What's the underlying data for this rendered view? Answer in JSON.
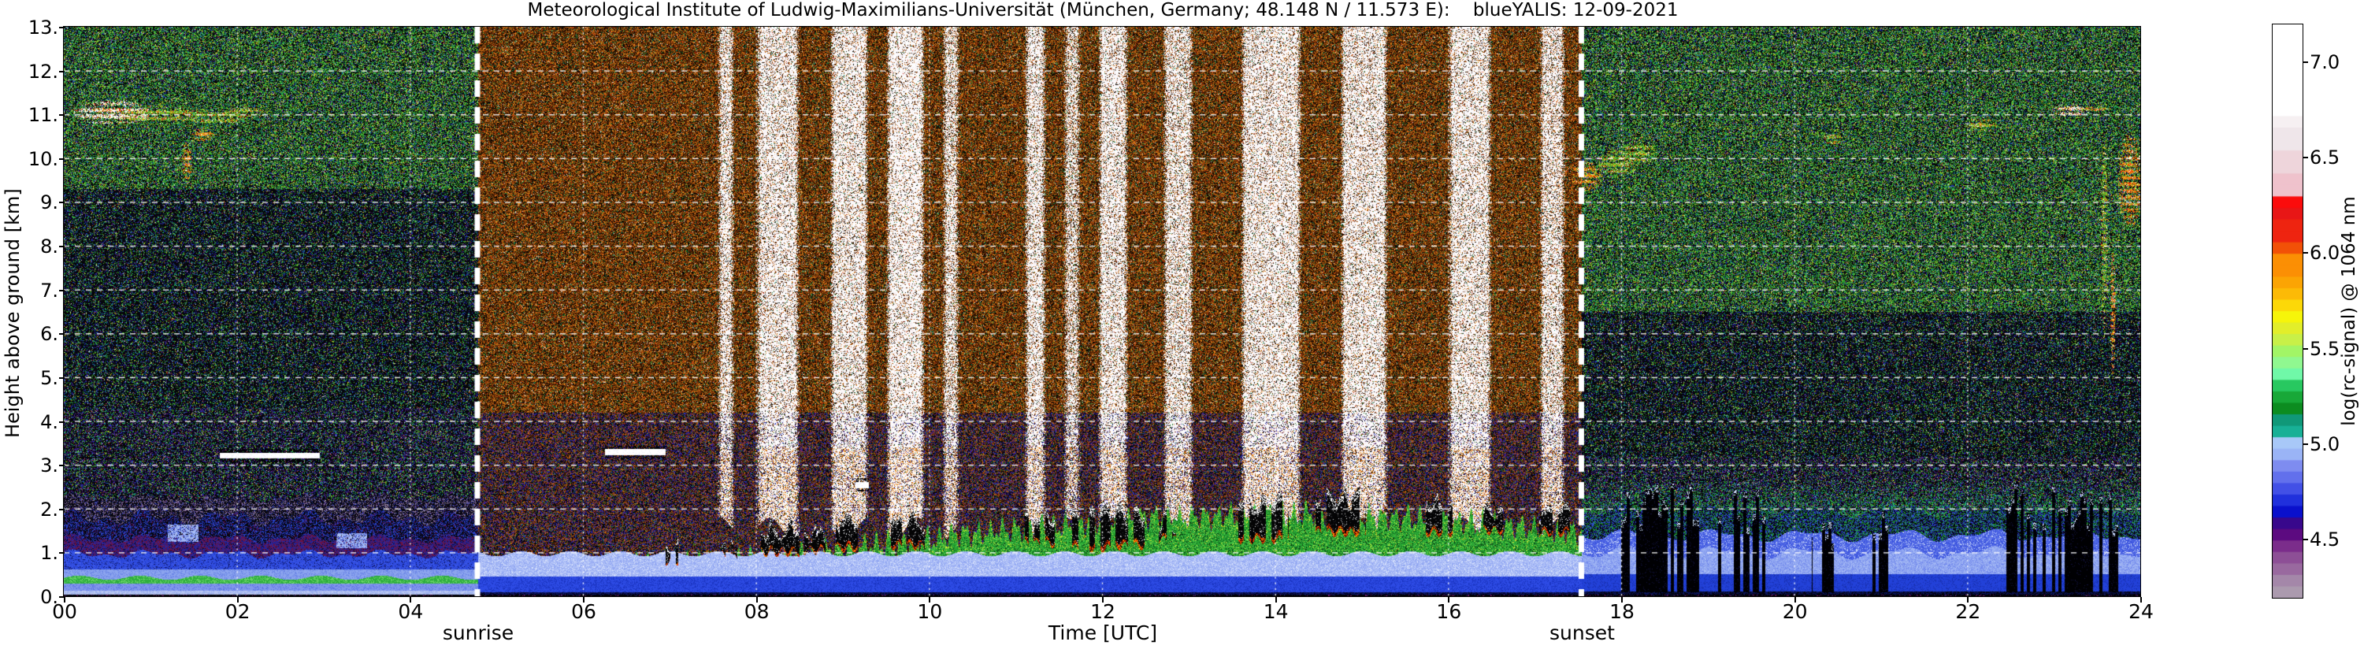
{
  "title": "Meteorological Institute of Ludwig-Maximilians-Universität (München, Germany; 48.148 N / 11.573 E):    blueYALIS: 12-09-2021",
  "axes": {
    "x_label": "Time [UTC]",
    "y_label": "Height above ground [km]",
    "x_ticks": [
      "00",
      "02",
      "04",
      "06",
      "08",
      "10",
      "12",
      "14",
      "16",
      "18",
      "20",
      "22",
      "24"
    ],
    "x_tick_hours": [
      0,
      2,
      4,
      6,
      8,
      10,
      12,
      14,
      16,
      18,
      20,
      22,
      24
    ],
    "y_ticks": [
      "0.",
      "1.",
      "2.",
      "3.",
      "4.",
      "5.",
      "6.",
      "7.",
      "8.",
      "9.",
      "10.",
      "11.",
      "12.",
      "13."
    ],
    "y_tick_km": [
      0,
      1,
      2,
      3,
      4,
      5,
      6,
      7,
      8,
      9,
      10,
      11,
      12,
      13
    ]
  },
  "annotations": {
    "sunrise": "sunrise",
    "sunset": "sunset"
  },
  "colorbar": {
    "label": "log(rc-signal) @ 1064 nm",
    "ticks": [
      "7.0",
      "6.5",
      "6.0",
      "5.5",
      "5.0",
      "4.5"
    ],
    "tick_values": [
      7.0,
      6.5,
      6.0,
      5.5,
      5.0,
      4.5
    ],
    "value_range": [
      4.2,
      7.2
    ],
    "bands": 50,
    "stops_desc": [
      [
        7.2,
        "#ffffff"
      ],
      [
        6.72,
        "#ffffff"
      ],
      [
        6.64,
        "#f6f0f2"
      ],
      [
        6.56,
        "#efe6ea"
      ],
      [
        6.44,
        "#eed5db"
      ],
      [
        6.32,
        "#efc2cc"
      ],
      [
        6.24,
        "#fb0c0c"
      ],
      [
        6.16,
        "#e81616"
      ],
      [
        6.06,
        "#ee2410"
      ],
      [
        5.98,
        "#f25107"
      ],
      [
        5.9,
        "#fb8f04"
      ],
      [
        5.82,
        "#fba404"
      ],
      [
        5.74,
        "#fcba06"
      ],
      [
        5.68,
        "#fcd808"
      ],
      [
        5.62,
        "#f6f50a"
      ],
      [
        5.56,
        "#e2ee2a"
      ],
      [
        5.5,
        "#c8f048"
      ],
      [
        5.455,
        "#a2f566"
      ],
      [
        5.41,
        "#90f890"
      ],
      [
        5.365,
        "#70f8a8"
      ],
      [
        5.32,
        "#38e088"
      ],
      [
        5.275,
        "#28c860"
      ],
      [
        5.23,
        "#18a838"
      ],
      [
        5.185,
        "#0c8c20"
      ],
      [
        5.14,
        "#087018"
      ],
      [
        5.095,
        "#109878"
      ],
      [
        5.05,
        "#18b096"
      ],
      [
        5.005,
        "#a8c8f8"
      ],
      [
        4.95,
        "#9ab4f6"
      ],
      [
        4.9,
        "#8ca0f4"
      ],
      [
        4.85,
        "#7e8cf0"
      ],
      [
        4.8,
        "#6270ec"
      ],
      [
        4.75,
        "#4250e6"
      ],
      [
        4.7,
        "#2030dc"
      ],
      [
        4.65,
        "#0a10cc"
      ],
      [
        4.6,
        "#1808a8"
      ],
      [
        4.55,
        "#38088c"
      ],
      [
        4.5,
        "#5c0a80"
      ],
      [
        4.45,
        "#7b2d8b"
      ],
      [
        4.4,
        "#8d4f96"
      ],
      [
        4.35,
        "#99699f"
      ],
      [
        4.29,
        "#a487a9"
      ],
      [
        4.2,
        "#ab9aae"
      ]
    ]
  },
  "chart_data": {
    "type": "heatmap",
    "title": "Meteorological Institute of Ludwig-Maximilians-Universität (München, Germany; 48.148 N / 11.573 E):    blueYALIS: 12-09-2021",
    "instrument": "blueYALIS",
    "date": "12-09-2021",
    "location": "48.148 N / 11.573 E",
    "xlabel": "Time [UTC]",
    "ylabel": "Height above ground [km]",
    "value_label": "log(rc-signal) @ 1064 nm",
    "x_range": [
      0,
      24
    ],
    "y_range": [
      0,
      13
    ],
    "value_range": [
      4.2,
      7.2
    ],
    "sunrise_utc": 4.78,
    "sunset_utc": 17.54,
    "grid": {
      "h_lines_km": [
        1,
        2,
        3,
        4,
        5,
        6,
        7,
        8,
        9,
        10,
        11,
        12
      ],
      "v_lines_hours": [
        2,
        4,
        6,
        8,
        10,
        12,
        14,
        16,
        18,
        20,
        22
      ]
    },
    "description": "Lidar range-corrected signal quicklook: night-time dark speckle background, daylight brown noise between sunrise and sunset dashed lines, cirrus 10-11.5 km near 00-02 UTC and 22-24 UTC, boundary-layer aerosol below ~2 km, daytime cumulus with black attenuation streaks 1-2.3 km, bright saturated columns during day, dark vertical streaks after sunset.",
    "features": {
      "bl_top_day": [
        [
          5,
          0.55
        ],
        [
          7,
          0.7
        ],
        [
          8,
          0.9
        ],
        [
          9.5,
          1.2
        ],
        [
          11,
          1.55
        ],
        [
          12.5,
          1.8
        ],
        [
          14,
          1.9
        ],
        [
          15.5,
          1.8
        ],
        [
          16.5,
          1.65
        ],
        [
          17.6,
          1.45
        ]
      ],
      "bright_stripes": [
        [
          7.55,
          7.75,
          0.85
        ],
        [
          8.0,
          8.5,
          0.9
        ],
        [
          8.85,
          9.3,
          0.9
        ],
        [
          9.5,
          9.95,
          0.95
        ],
        [
          10.15,
          10.35,
          0.8
        ],
        [
          11.1,
          11.35,
          0.9
        ],
        [
          11.55,
          11.75,
          0.75
        ],
        [
          11.95,
          12.3,
          0.9
        ],
        [
          12.7,
          13.05,
          0.85
        ],
        [
          13.6,
          14.3,
          0.9
        ],
        [
          14.75,
          15.3,
          0.9
        ],
        [
          16.0,
          16.5,
          0.9
        ],
        [
          17.05,
          17.35,
          0.85
        ]
      ],
      "cumulus": [
        [
          6.95,
          7.1,
          0.8,
          1.1
        ],
        [
          7.6,
          7.78,
          0.95,
          1.25
        ],
        [
          8.05,
          8.5,
          1.0,
          1.55
        ],
        [
          8.55,
          8.8,
          1.05,
          1.5
        ],
        [
          8.85,
          9.25,
          1.1,
          1.75
        ],
        [
          9.55,
          9.95,
          1.15,
          1.7
        ],
        [
          11.1,
          11.45,
          1.2,
          1.85
        ],
        [
          11.65,
          12.1,
          1.1,
          1.9
        ],
        [
          12.15,
          12.5,
          1.15,
          1.95
        ],
        [
          12.65,
          12.85,
          1.3,
          1.75
        ],
        [
          13.55,
          14.15,
          1.3,
          2.15
        ],
        [
          14.4,
          15.05,
          1.45,
          2.3
        ],
        [
          15.7,
          16.05,
          1.45,
          2.1
        ],
        [
          16.4,
          16.65,
          1.5,
          2.0
        ],
        [
          17.05,
          17.4,
          1.45,
          2.0
        ]
      ],
      "dark_streaks": [
        [
          18.0,
          18.9,
          2.3,
          0.78
        ],
        [
          19.1,
          19.8,
          2.2,
          0.6
        ],
        [
          20.2,
          20.45,
          1.8,
          0.4
        ],
        [
          20.9,
          21.15,
          2.0,
          0.5
        ],
        [
          22.45,
          23.8,
          2.3,
          0.72
        ]
      ],
      "cloud_blobs": [
        [
          0.55,
          11.05,
          0.45,
          0.28,
          2
        ],
        [
          1.1,
          11.0,
          0.55,
          0.22,
          0
        ],
        [
          1.75,
          10.95,
          0.35,
          0.18,
          0
        ],
        [
          2.1,
          11.05,
          0.25,
          0.12,
          0
        ],
        [
          1.42,
          9.95,
          0.06,
          0.45,
          1
        ],
        [
          1.6,
          10.55,
          0.15,
          0.15,
          1
        ],
        [
          17.6,
          9.6,
          0.18,
          0.33,
          1
        ],
        [
          17.95,
          9.9,
          0.25,
          0.3,
          0
        ],
        [
          18.2,
          10.15,
          0.2,
          0.25,
          0
        ],
        [
          20.45,
          10.45,
          0.15,
          0.12,
          0
        ],
        [
          22.15,
          10.75,
          0.2,
          0.15,
          0
        ],
        [
          23.2,
          11.1,
          0.22,
          0.13,
          2
        ],
        [
          23.5,
          11.15,
          0.18,
          0.06,
          1
        ],
        [
          23.88,
          9.5,
          0.14,
          1.1,
          1
        ],
        [
          23.58,
          8.2,
          0.04,
          2.3,
          0
        ],
        [
          23.68,
          6.5,
          0.03,
          1.5,
          1
        ]
      ],
      "white_streaks": [
        [
          1.8,
          2.95,
          3.22
        ],
        [
          6.25,
          6.95,
          3.3
        ],
        [
          9.15,
          9.3,
          2.55
        ]
      ],
      "night_blobs": [
        [
          1.2,
          1.55,
          1.25,
          1.65
        ],
        [
          3.15,
          3.5,
          1.1,
          1.45
        ]
      ]
    }
  }
}
